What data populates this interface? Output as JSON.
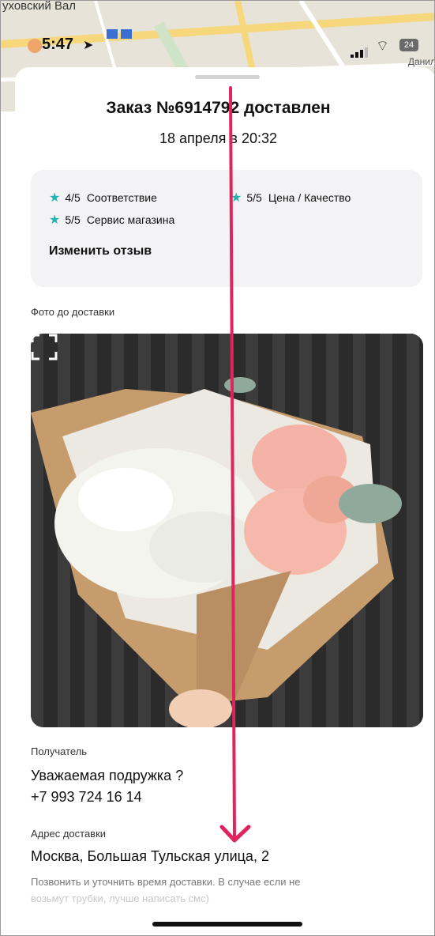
{
  "map": {
    "top_left_label": "ухов­ский Вал",
    "right_label": "Данил"
  },
  "status_bar": {
    "time": "5:47",
    "battery": "24"
  },
  "order": {
    "title": "Заказ №6914792 доставлен",
    "date": "18 апреля в 20:32"
  },
  "review": {
    "ratings": [
      {
        "score": "4/5",
        "label": "Соответствие"
      },
      {
        "score": "5/5",
        "label": "Цена / Качество"
      },
      {
        "score": "5/5",
        "label": "Сервис магазина"
      }
    ],
    "edit_label": "Изменить отзыв"
  },
  "photo_section": {
    "label": "Фото до доставки"
  },
  "recipient": {
    "label": "Получатель",
    "name": "Уважаемая подружка ?",
    "phone": "+7 993 724 16 14"
  },
  "delivery": {
    "label": "Адрес доставки",
    "address": "Москва, Большая Тульская улица, 2",
    "comment": "Позвонить и уточнить время доставки.  В случае если не",
    "comment_cut": "возьмут трубки, лучше написать смс)"
  },
  "colors": {
    "accent_star": "#20b3b0",
    "annotation_arrow": "#e0245e"
  }
}
